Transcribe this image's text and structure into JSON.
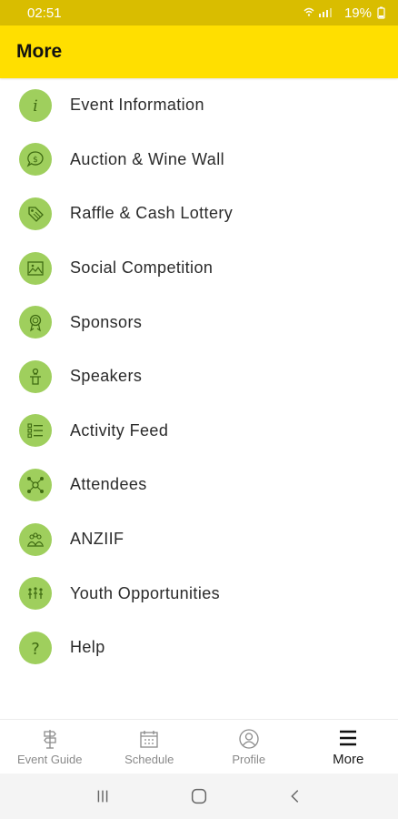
{
  "status": {
    "time": "02:51",
    "battery": "19%",
    "icons": "wifi signal battery"
  },
  "appbar": {
    "title": "More"
  },
  "menu": {
    "items": [
      {
        "label": "Event Information",
        "icon": "info-icon"
      },
      {
        "label": "Auction & Wine Wall",
        "icon": "dollar-bubble-icon"
      },
      {
        "label": "Raffle & Cash Lottery",
        "icon": "tag-icon"
      },
      {
        "label": "Social Competition",
        "icon": "image-icon"
      },
      {
        "label": "Sponsors",
        "icon": "award-ribbon-icon"
      },
      {
        "label": "Speakers",
        "icon": "speaker-podium-icon"
      },
      {
        "label": "Activity Feed",
        "icon": "list-icon"
      },
      {
        "label": "Attendees",
        "icon": "network-people-icon"
      },
      {
        "label": "ANZIIF",
        "icon": "group-icon"
      },
      {
        "label": "Youth Opportunities",
        "icon": "youth-people-icon"
      },
      {
        "label": "Help",
        "icon": "question-icon"
      }
    ]
  },
  "tabbar": {
    "tabs": [
      {
        "label": "Event Guide",
        "icon": "signpost-icon",
        "active": false
      },
      {
        "label": "Schedule",
        "icon": "calendar-icon",
        "active": false
      },
      {
        "label": "Profile",
        "icon": "profile-icon",
        "active": false
      },
      {
        "label": "More",
        "icon": "menu-icon",
        "active": true
      }
    ]
  },
  "colors": {
    "statusbar": "#d9bd00",
    "appbar": "#ffdf00",
    "icon_circle": "#9fcf5d",
    "icon_stroke": "#3f6b12"
  }
}
